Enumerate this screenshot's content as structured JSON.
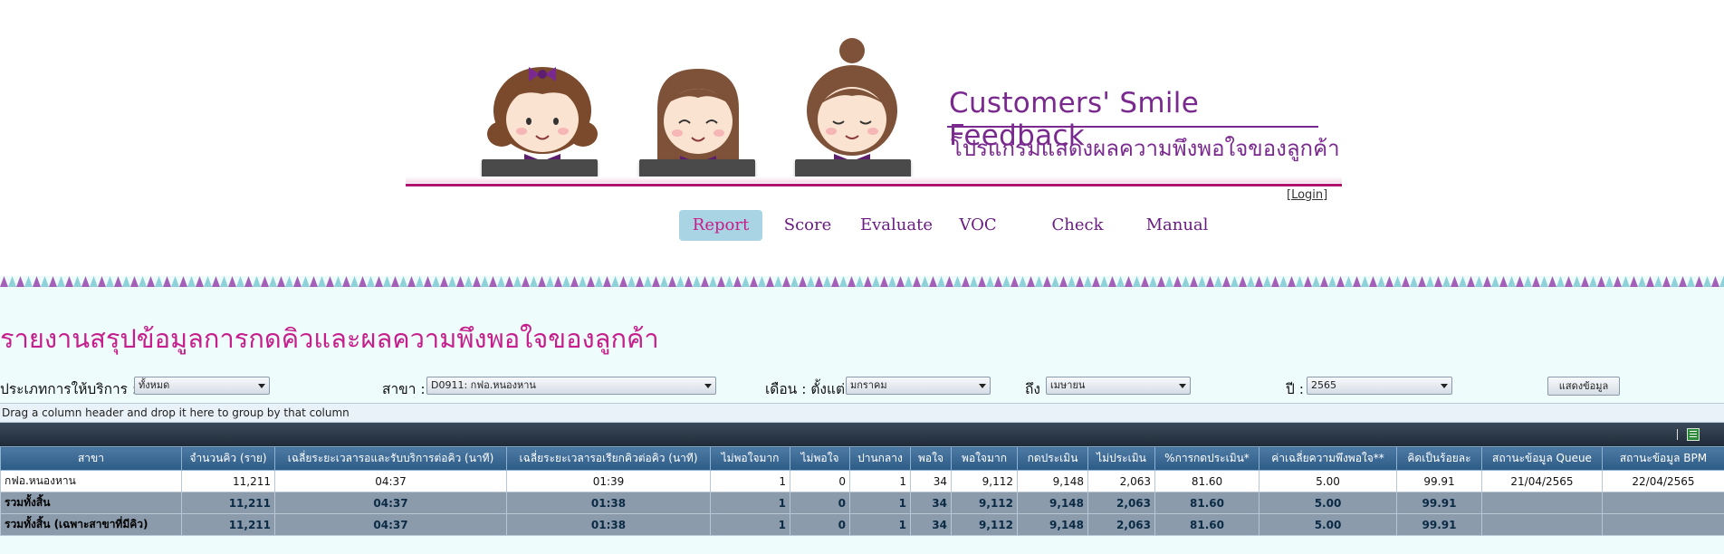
{
  "brand": {
    "title": "Customers' Smile Feedback",
    "subtitle": "โปรแกรมแสดงผลความพึงพอใจของลูกค้า",
    "accent_color": "#7a2a8f",
    "line_color": "#b0136e"
  },
  "login": {
    "prefix": "[",
    "label": "Login",
    "suffix": "]"
  },
  "nav": {
    "items": [
      {
        "label": "Report",
        "active": true
      },
      {
        "label": "Score",
        "active": false
      },
      {
        "label": "Evaluate",
        "active": false
      },
      {
        "label": "VOC",
        "active": false
      },
      {
        "label": "Check",
        "active": false
      },
      {
        "label": "Manual",
        "active": false
      }
    ]
  },
  "page": {
    "title": "รายงานสรุปข้อมูลการกดคิวและผลความพึงพอใจของลูกค้า",
    "title_color": "#c61e8c",
    "background": "#eefcfc"
  },
  "filters": {
    "service_type": {
      "label": "ประเภทการให้บริการ :",
      "value": "ทั้งหมด"
    },
    "branch": {
      "label": "สาขา :",
      "value": "D0911: กฟอ.หนองหาน"
    },
    "month_from": {
      "label": "เดือน : ตั้งแต่",
      "value": "มกราคม"
    },
    "month_to": {
      "label": "ถึง",
      "value": "เมษายน"
    },
    "year": {
      "label": "ปี :",
      "value": "2565"
    },
    "show_button": "แสดงข้อมูล"
  },
  "grid": {
    "group_hint": "Drag a column header and drop it here to group by that column",
    "export_icon": "excel-icon",
    "columns": [
      "สาขา",
      "จำนวนคิว (ราย)",
      "เฉลี่ยระยะเวลารอและรับบริการต่อคิว (นาที)",
      "เฉลี่ยระยะเวลารอเรียกคิวต่อคิว (นาที)",
      "ไม่พอใจมาก",
      "ไม่พอใจ",
      "ปานกลาง",
      "พอใจ",
      "พอใจมาก",
      "กดประเมิน",
      "ไม่ประเมิน",
      "%การกดประเมิน*",
      "ค่าเฉลี่ยความพึงพอใจ**",
      "คิดเป็นร้อยละ",
      "สถานะข้อมูล Queue",
      "สถานะข้อมูล BPM"
    ],
    "rows": [
      [
        "กฟอ.หนองหาน",
        "11,211",
        "04:37",
        "01:39",
        "1",
        "0",
        "1",
        "34",
        "9,112",
        "9,148",
        "2,063",
        "81.60",
        "5.00",
        "99.91",
        "21/04/2565",
        "22/04/2565"
      ]
    ],
    "summary_rows": [
      [
        "รวมทั้งสิ้น",
        "11,211",
        "04:37",
        "01:38",
        "1",
        "0",
        "1",
        "34",
        "9,112",
        "9,148",
        "2,063",
        "81.60",
        "5.00",
        "99.91",
        "",
        ""
      ],
      [
        "รวมทั้งสิ้น (เฉพาะสาขาที่มีคิว)",
        "11,211",
        "04:37",
        "01:38",
        "1",
        "0",
        "1",
        "34",
        "9,112",
        "9,148",
        "2,063",
        "81.60",
        "5.00",
        "99.91",
        "",
        ""
      ]
    ]
  }
}
